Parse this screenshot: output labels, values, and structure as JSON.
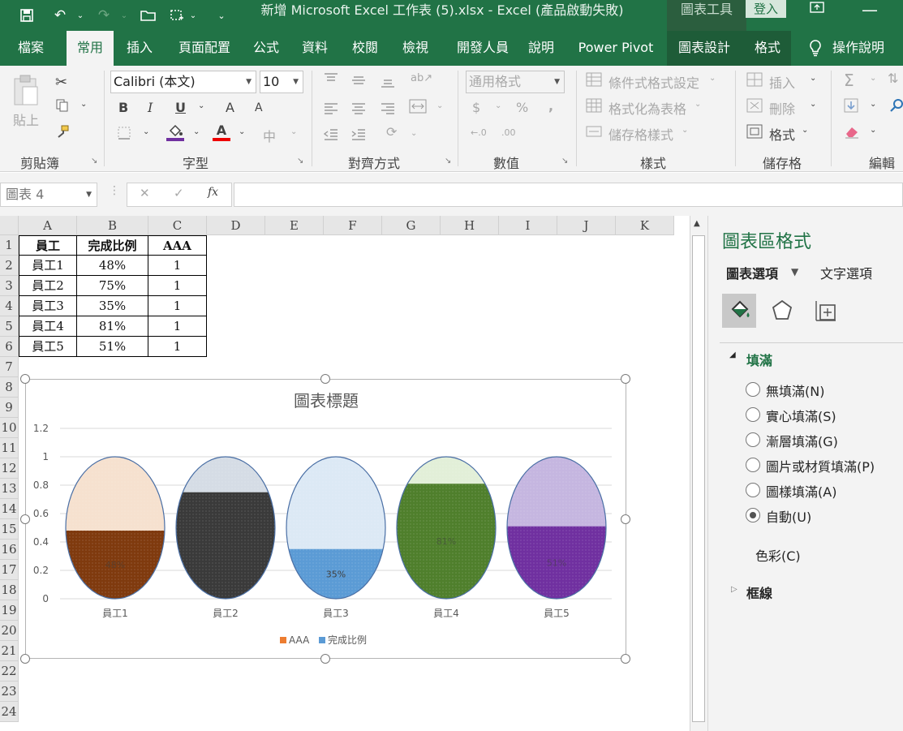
{
  "title_bar": {
    "doc_title": "新增 Microsoft Excel 工作表 (5).xlsx  -  Excel (產品啟動失敗)",
    "context_tools": "圖表工具",
    "login": "登入"
  },
  "tabs": [
    "檔案",
    "常用",
    "插入",
    "頁面配置",
    "公式",
    "資料",
    "校閱",
    "檢視",
    "開發人員",
    "說明",
    "Power Pivot",
    "圖表設計",
    "格式"
  ],
  "active_tab": "常用",
  "tell_me": "操作說明",
  "ribbon": {
    "clipboard": {
      "paste": "貼上",
      "label": "剪貼簿"
    },
    "font": {
      "name": "Calibri (本文)",
      "size": "10",
      "label": "字型",
      "bold": "B",
      "italic": "I",
      "underline": "U",
      "grow": "A",
      "shrink": "A",
      "fill_letter": "A",
      "font_color_letter": "A",
      "phonetic": "中"
    },
    "alignment": {
      "label": "對齊方式"
    },
    "number": {
      "format": "通用格式",
      "label": "數值",
      "currency": "$",
      "percent": "%",
      "comma": ",",
      "inc_decimal": "←.0",
      "dec_decimal": ".00"
    },
    "styles": {
      "conditional": "條件式格式設定",
      "table": "格式化為表格",
      "cell_styles": "儲存格樣式",
      "label": "樣式"
    },
    "cells": {
      "insert": "插入",
      "delete": "刪除",
      "format": "格式",
      "label": "儲存格"
    },
    "editing": {
      "label": "編輯",
      "sum": "Σ"
    }
  },
  "formula_bar": {
    "name_box": "圖表 4",
    "fx": "fx"
  },
  "columns": [
    "A",
    "B",
    "C",
    "D",
    "E",
    "F",
    "G",
    "H",
    "I",
    "J",
    "K"
  ],
  "rows": [
    "1",
    "2",
    "3",
    "4",
    "5",
    "6",
    "7",
    "8",
    "9",
    "10",
    "11",
    "12",
    "13",
    "14",
    "15",
    "16",
    "17",
    "18",
    "19",
    "20",
    "21",
    "22",
    "23",
    "24"
  ],
  "table": {
    "headers": [
      "員工",
      "完成比例",
      "AAA"
    ],
    "rows": [
      [
        "員工1",
        "48%",
        "1"
      ],
      [
        "員工2",
        "75%",
        "1"
      ],
      [
        "員工3",
        "35%",
        "1"
      ],
      [
        "員工4",
        "81%",
        "1"
      ],
      [
        "員工5",
        "51%",
        "1"
      ]
    ]
  },
  "chart_data": {
    "type": "bar",
    "title": "圖表標題",
    "categories": [
      "員工1",
      "員工2",
      "員工3",
      "員工4",
      "員工5"
    ],
    "series": [
      {
        "name": "AAA",
        "values": [
          1,
          1,
          1,
          1,
          1
        ]
      },
      {
        "name": "完成比例",
        "values": [
          0.48,
          0.75,
          0.35,
          0.81,
          0.51
        ]
      }
    ],
    "data_labels": [
      "48%",
      "75%",
      "35%",
      "81%",
      "51%"
    ],
    "y_ticks": [
      "1.2",
      "1",
      "0.8",
      "0.6",
      "0.4",
      "0.2",
      "0"
    ],
    "ylim": [
      0,
      1.2
    ],
    "grid": true,
    "legend": "bottom",
    "legend_swatches": [
      "#ed7d31",
      "#5b9bd5"
    ],
    "fill_colors": [
      "#7f3a0e",
      "#3a3a3a",
      "#5b9bd5",
      "#4f7f2c",
      "#7030a0"
    ],
    "empty_colors": [
      "#f6e1cf",
      "#d5dce5",
      "#dce9f5",
      "#e2efd8",
      "#c5b6e0"
    ]
  },
  "format_pane": {
    "title": "圖表區格式",
    "tab_chart": "圖表選項",
    "tab_text": "文字選項",
    "fill_section": "填滿",
    "fill_options": [
      "無填滿(N)",
      "實心填滿(S)",
      "漸層填滿(G)",
      "圖片或材質填滿(P)",
      "圖樣填滿(A)",
      "自動(U)"
    ],
    "selected": 5,
    "color_label": "色彩(C)",
    "border_section": "框線"
  },
  "theme": {
    "accent": "#217346"
  }
}
